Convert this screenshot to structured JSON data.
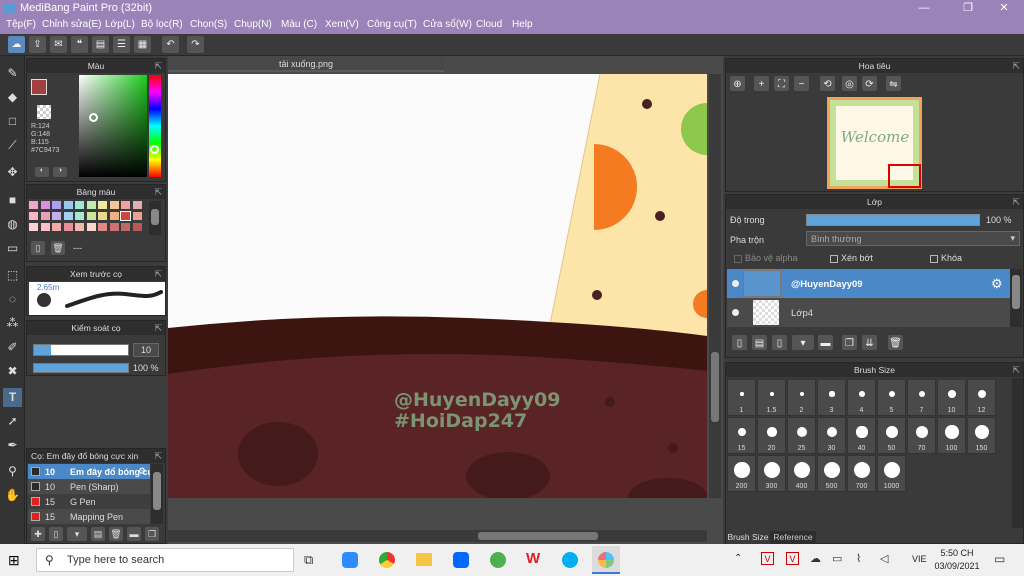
{
  "window": {
    "title": "MediBang Paint Pro (32bit)",
    "minimize": "—",
    "maximize": "❐",
    "close": "✕"
  },
  "menu": [
    "Tệp(F)",
    "Chỉnh sửa(E)",
    "Lớp(L)",
    "Bộ lọc(R)",
    "Chọn(S)",
    "Chụp(N)",
    "Màu (C)",
    "Xem(V)",
    "Công cụ(T)",
    "Cửa sổ(W)",
    "Cloud",
    "Help"
  ],
  "color_panel": {
    "title": "Màu",
    "r": "R:124",
    "g": "G:148",
    "b": "B:115",
    "hex": "#7C9473",
    "fg": "#a04040",
    "bg": "#ffffff"
  },
  "palette_panel": {
    "title": "Bảng màu",
    "name": "---"
  },
  "brush_preview": {
    "title": "Xem trước cọ",
    "size": "2.65m"
  },
  "brush_control": {
    "title": "Kiểm soát cọ",
    "size": "10",
    "opacity": "100 %"
  },
  "brush_list": {
    "title": "Cọ: Em đây đổ bóng cực xịn",
    "items": [
      {
        "size": "10",
        "name": "Em đây đổ bóng cực xịn",
        "color": "#2a2a2a"
      },
      {
        "size": "10",
        "name": "Pen (Sharp)",
        "color": "#2a2a2a"
      },
      {
        "size": "15",
        "name": "G Pen",
        "color": "#e02020"
      },
      {
        "size": "15",
        "name": "Mapping Pen",
        "color": "#e02020"
      }
    ]
  },
  "document": {
    "tab": "tải xuống.png",
    "watermark1": "@HuyenDayy09",
    "watermark2": "#HoiDap247"
  },
  "navigator": {
    "title": "Hoa tiêu",
    "thumb_text": "Welcome"
  },
  "layers": {
    "title": "Lớp",
    "opacity_label": "Độ trong",
    "opacity_value": "100 %",
    "blend_label": "Pha trộn",
    "blend_value": "Bình thường",
    "protect_alpha": "Bảo vệ alpha",
    "clipping": "Xén bớt",
    "lock": "Khóa",
    "items": [
      {
        "name": "@HuyenDayy09"
      },
      {
        "name": "Lớp4"
      }
    ]
  },
  "brush_size": {
    "title": "Brush Size",
    "sizes": [
      "1",
      "1.5",
      "2",
      "3",
      "4",
      "5",
      "7",
      "10",
      "12",
      "15",
      "20",
      "25",
      "30",
      "40",
      "50",
      "70",
      "100",
      "150",
      "200",
      "300",
      "400",
      "500",
      "700",
      "1000"
    ],
    "tabs": [
      "Brush Size",
      "Reference"
    ]
  },
  "taskbar": {
    "search_placeholder": "Type here to search",
    "lang": "VIE",
    "time": "5:50 CH",
    "date": "03/09/2021"
  }
}
